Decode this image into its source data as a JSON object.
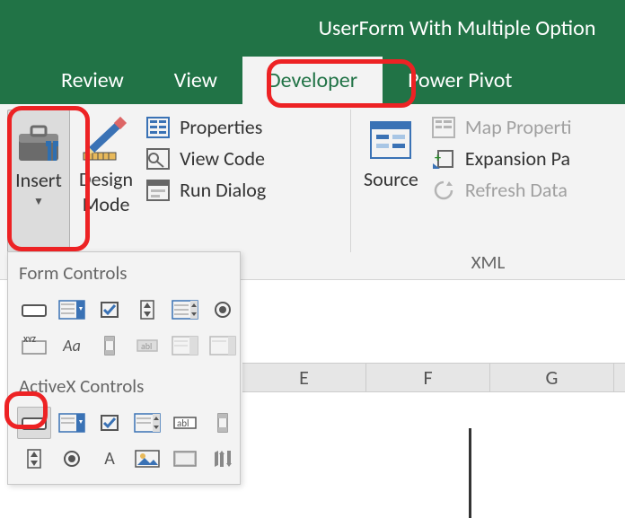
{
  "title": "UserForm With Multiple Option",
  "tabs": [
    {
      "label": "Review"
    },
    {
      "label": "View"
    },
    {
      "label": "Developer",
      "active": true
    },
    {
      "label": "Power Pivot"
    }
  ],
  "ribbon": {
    "insert": {
      "label": "Insert"
    },
    "design_mode": {
      "label1": "Design",
      "label2": "Mode"
    },
    "controls": {
      "properties": "Properties",
      "view_code": "View Code",
      "run_dialog": "Run Dialog"
    },
    "source": {
      "label": "Source"
    },
    "xml": {
      "label": "XML",
      "map_properties": "Map Properti",
      "expansion": "Expansion Pa",
      "refresh": "Refresh Data"
    }
  },
  "dropdown": {
    "form_header": "Form Controls",
    "activex_header": "ActiveX Controls"
  },
  "columns": [
    "E",
    "F",
    "G"
  ]
}
